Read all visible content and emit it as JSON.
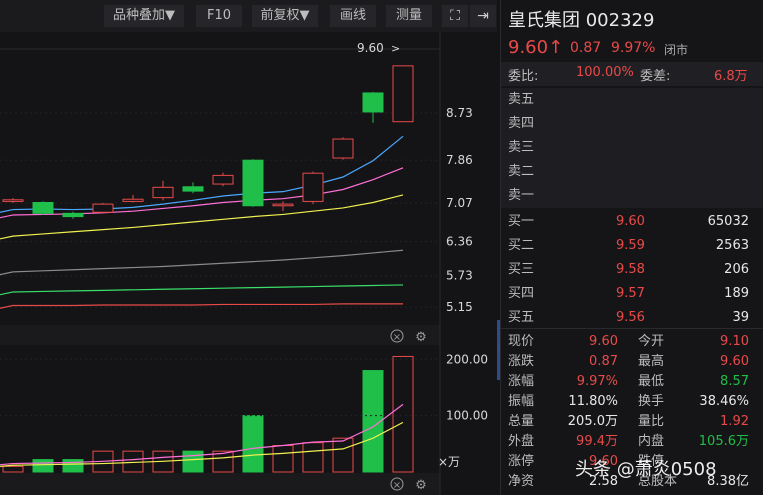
{
  "toolbar": {
    "overlay_label": "品种叠加▼",
    "f10_label": "F10",
    "adjust_label": "前复权▼",
    "draw_label": "画线",
    "measure_label": "测量"
  },
  "price_axis": [
    "8.73",
    "7.86",
    "7.07",
    "6.36",
    "5.73",
    "5.15"
  ],
  "last_price_tag": "9.60",
  "volume_axis": [
    "200.00",
    "100.00"
  ],
  "volume_unit": "×万",
  "stock": {
    "name": "皇氏集团",
    "code": "002329",
    "price": "9.60",
    "arrow": "↑",
    "change": "0.87",
    "change_pct": "9.97%",
    "status": "闭市"
  },
  "committee": {
    "ratio_label": "委比:",
    "ratio_value": "100.00%",
    "diff_label": "委差:",
    "diff_value": "6.8万"
  },
  "asks": [
    {
      "label": "卖五",
      "price": "",
      "volume": ""
    },
    {
      "label": "卖四",
      "price": "",
      "volume": ""
    },
    {
      "label": "卖三",
      "price": "",
      "volume": ""
    },
    {
      "label": "卖二",
      "price": "",
      "volume": ""
    },
    {
      "label": "卖一",
      "price": "",
      "volume": ""
    }
  ],
  "bids": [
    {
      "label": "买一",
      "price": "9.60",
      "volume": "65032"
    },
    {
      "label": "买二",
      "price": "9.59",
      "volume": "2563"
    },
    {
      "label": "买三",
      "price": "9.58",
      "volume": "206"
    },
    {
      "label": "买四",
      "price": "9.57",
      "volume": "189"
    },
    {
      "label": "买五",
      "price": "9.56",
      "volume": "39"
    }
  ],
  "stats": [
    {
      "l1": "现价",
      "v1": "9.60",
      "c1": "red",
      "l2": "今开",
      "v2": "9.10",
      "c2": "red"
    },
    {
      "l1": "涨跌",
      "v1": "0.87",
      "c1": "red",
      "l2": "最高",
      "v2": "9.60",
      "c2": "red"
    },
    {
      "l1": "涨幅",
      "v1": "9.97%",
      "c1": "red",
      "l2": "最低",
      "v2": "8.57",
      "c2": "green"
    },
    {
      "l1": "振幅",
      "v1": "11.80%",
      "c1": "white",
      "l2": "换手",
      "v2": "38.46%",
      "c2": "white"
    },
    {
      "l1": "总量",
      "v1": "205.0万",
      "c1": "white",
      "l2": "量比",
      "v2": "1.92",
      "c2": "red"
    },
    {
      "l1": "外盘",
      "v1": "99.4万",
      "c1": "red",
      "l2": "内盘",
      "v2": "105.6万",
      "c2": "green"
    },
    {
      "l1": "涨停",
      "v1": "9.60",
      "c1": "red",
      "l2": "跌停",
      "v2": "",
      "c2": "green"
    },
    {
      "l1": "净资",
      "v1": "2.58",
      "c1": "white",
      "l2": "总股本",
      "v2": "8.38亿",
      "c2": "white"
    }
  ],
  "watermark": "头条 @萧炎0508",
  "colors": {
    "up": "#e84a4a",
    "down": "#1fbf4a",
    "ma5": "#4aa8ff",
    "ma10": "#ff6fd8",
    "ma20": "#f0f050",
    "ma60": "#8a8a8a",
    "ma120": "#3adf6a",
    "ma250": "#e84a4a"
  },
  "chart_data": {
    "type": "candlestick",
    "candles": [
      {
        "o": 7.1,
        "c": 7.13,
        "h": 7.16,
        "l": 7.07
      },
      {
        "o": 7.08,
        "c": 6.88,
        "h": 7.1,
        "l": 6.85
      },
      {
        "o": 6.88,
        "c": 6.82,
        "h": 6.91,
        "l": 6.78
      },
      {
        "o": 6.9,
        "c": 7.05,
        "h": 7.07,
        "l": 6.88
      },
      {
        "o": 7.1,
        "c": 7.14,
        "h": 7.22,
        "l": 7.08
      },
      {
        "o": 7.17,
        "c": 7.36,
        "h": 7.48,
        "l": 7.12
      },
      {
        "o": 7.37,
        "c": 7.29,
        "h": 7.45,
        "l": 7.25
      },
      {
        "o": 7.42,
        "c": 7.58,
        "h": 7.63,
        "l": 7.38
      },
      {
        "o": 7.86,
        "c": 7.02,
        "h": 7.88,
        "l": 7.0
      },
      {
        "o": 7.02,
        "c": 7.05,
        "h": 7.1,
        "l": 6.92
      },
      {
        "o": 7.1,
        "c": 7.62,
        "h": 7.65,
        "l": 7.05
      },
      {
        "o": 7.9,
        "c": 8.25,
        "h": 8.28,
        "l": 7.87
      },
      {
        "o": 9.1,
        "c": 8.75,
        "h": 9.12,
        "l": 8.55
      },
      {
        "o": 8.57,
        "c": 9.6,
        "h": 9.6,
        "l": 8.57
      }
    ],
    "ma5": [
      6.95,
      6.96,
      6.95,
      6.96,
      6.99,
      7.05,
      7.12,
      7.2,
      7.25,
      7.28,
      7.4,
      7.55,
      7.85,
      8.3
    ],
    "ma10": [
      6.85,
      6.86,
      6.87,
      6.89,
      6.92,
      6.97,
      7.02,
      7.08,
      7.12,
      7.15,
      7.22,
      7.32,
      7.5,
      7.72
    ],
    "ma20": [
      6.46,
      6.5,
      6.54,
      6.58,
      6.62,
      6.67,
      6.72,
      6.77,
      6.82,
      6.86,
      6.92,
      6.98,
      7.08,
      7.22
    ],
    "ma60": [
      5.8,
      5.82,
      5.84,
      5.86,
      5.88,
      5.9,
      5.93,
      5.96,
      5.99,
      6.02,
      6.06,
      6.1,
      6.15,
      6.2
    ],
    "ma120": [
      5.43,
      5.44,
      5.45,
      5.46,
      5.47,
      5.48,
      5.49,
      5.5,
      5.51,
      5.52,
      5.53,
      5.54,
      5.55,
      5.56
    ],
    "ma250": [
      5.18,
      5.18,
      5.18,
      5.19,
      5.19,
      5.19,
      5.19,
      5.2,
      5.2,
      5.2,
      5.2,
      5.21,
      5.21,
      5.21
    ],
    "volumes": [
      10,
      22,
      22,
      37,
      37,
      37,
      37,
      37,
      100,
      47,
      52,
      60,
      180,
      205
    ],
    "vol_ma5": [
      15,
      16,
      17,
      19,
      22,
      26,
      29,
      33,
      42,
      47,
      53,
      55,
      80,
      120
    ],
    "vol_ma10": [
      12,
      13,
      14,
      15,
      17,
      19,
      22,
      25,
      30,
      33,
      37,
      41,
      60,
      88
    ],
    "price_range": [
      4.95,
      9.8
    ],
    "volume_range": [
      0,
      220
    ]
  }
}
